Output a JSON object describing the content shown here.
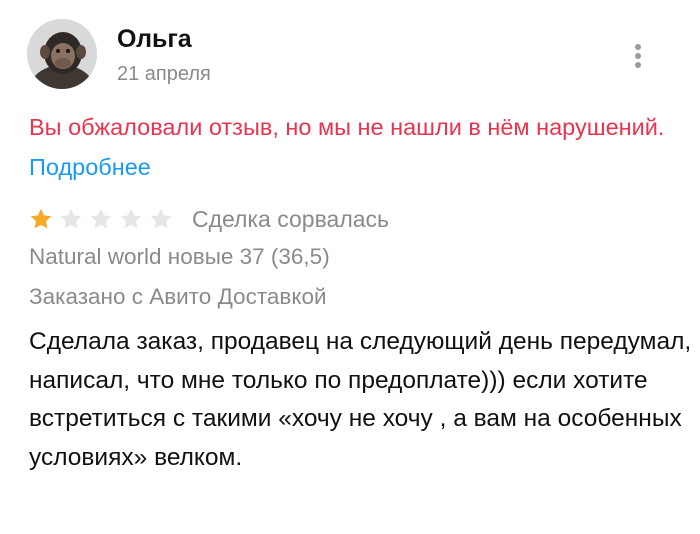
{
  "review": {
    "author": {
      "name": "Ольга",
      "date": "21 апреля"
    },
    "notice": {
      "text": "Вы обжаловали отзыв, но мы не нашли в нём нарушений.",
      "link_label": "Подробнее"
    },
    "rating": {
      "value": 1,
      "max": 5,
      "status": "Сделка сорвалась"
    },
    "item_title": "Natural world новые 37 (36,5)",
    "delivery": "Заказано с Авито Доставкой",
    "body": "Сделала заказ, продавец на следующий день передумал, написал, что мне только по предоплате))) если хотите встретиться с такими «хочу не хочу , а вам на особенных условиях» велком."
  },
  "colors": {
    "notice_text": "#e8344f",
    "link": "#1a9af0",
    "star_filled": "#f7a824",
    "star_empty": "#e6e6e6",
    "secondary_text": "#8a8a8a"
  },
  "icons": {
    "more": "more-vertical-icon",
    "star": "star-icon"
  }
}
